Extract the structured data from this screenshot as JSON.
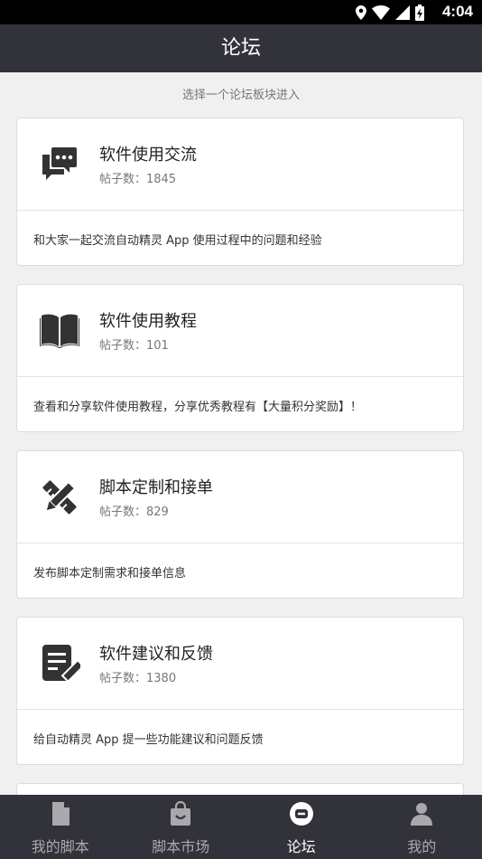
{
  "status": {
    "time": "4:04"
  },
  "appbar": {
    "title": "论坛"
  },
  "hint": "选择一个论坛板块进入",
  "forums": [
    {
      "name": "软件使用交流",
      "count": "帖子数：1845",
      "description": "和大家一起交流自动精灵 App 使用过程中的问题和经验",
      "icon": "chat-bubbles-icon"
    },
    {
      "name": "软件使用教程",
      "count": "帖子数：101",
      "description": "查看和分享软件使用教程，分享优秀教程有【大量积分奖励】！",
      "icon": "book-icon"
    },
    {
      "name": "脚本定制和接单",
      "count": "帖子数：829",
      "description": "发布脚本定制需求和接单信息",
      "icon": "ruler-pencil-icon"
    },
    {
      "name": "软件建议和反馈",
      "count": "帖子数：1380",
      "description": "给自动精灵 App 提一些功能建议和问题反馈",
      "icon": "note-edit-icon"
    }
  ],
  "bottom_nav": [
    {
      "label": "我的脚本",
      "icon": "file-icon",
      "active": false
    },
    {
      "label": "脚本市场",
      "icon": "shopping-bag-icon",
      "active": false
    },
    {
      "label": "论坛",
      "icon": "forum-icon",
      "active": true
    },
    {
      "label": "我的",
      "icon": "person-icon",
      "active": false
    }
  ],
  "colors": {
    "appbar": "#31323a",
    "background": "#f0f0f0",
    "icon": "#333333"
  }
}
